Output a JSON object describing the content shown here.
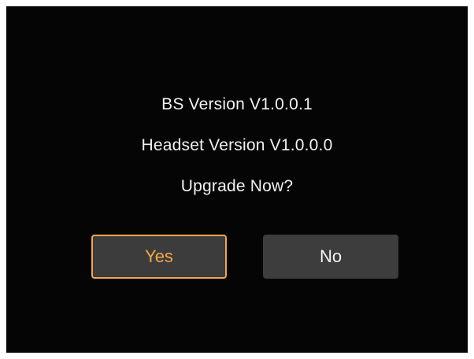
{
  "dialog": {
    "bs_version": "BS Version V1.0.0.1",
    "headset_version": "Headset Version V1.0.0.0",
    "prompt": "Upgrade Now?",
    "yes_label": "Yes",
    "no_label": "No"
  },
  "colors": {
    "background": "#050505",
    "text": "#f2f2f2",
    "accent": "#f3a64a",
    "button": "#3d3d3d"
  }
}
